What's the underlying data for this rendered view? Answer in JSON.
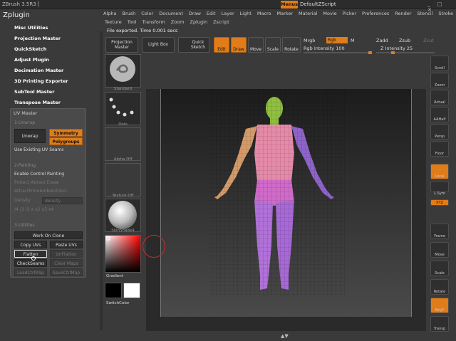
{
  "window": {
    "title": "ZBrush 3.5R3 [",
    "menus_label": "Menus",
    "script_name": "DefaultZScript"
  },
  "menubar": {
    "row1": [
      "Alpha",
      "Brush",
      "Color",
      "Document",
      "Draw",
      "Edit",
      "Layer",
      "Light",
      "Macro",
      "Marker",
      "Material",
      "Movie",
      "Picker",
      "Preferences",
      "Render",
      "Stencil",
      "Stroke"
    ],
    "row2": [
      "Texture",
      "Tool",
      "Transform",
      "Zoom",
      "Zplugin",
      "Zscript"
    ]
  },
  "status": "File exported. Time 0.001 secs",
  "zplugin": {
    "title": "Zplugin",
    "items": [
      "Misc Utilities",
      "Projection Master",
      "QuickSketch",
      "Adjust Plugin",
      "Decimation Master",
      "3D Printing Exporter",
      "SubTool Master",
      "Transpose Master"
    ]
  },
  "uvmaster": {
    "title": "UV Master",
    "sec1": "1-Unwrap",
    "unwrap": "Unwrap",
    "symmetry": "Symmetry",
    "polygroups": "Polygroups",
    "use_existing": "Use Existing UV Seams",
    "sec2": "2-Painting",
    "enable_cp": "Enable Control Painting",
    "protect_attract": "Protect  Attract  Erase",
    "attract_ao": "AttractFromAmbientOccl",
    "density": "Density",
    "density_slider": "density",
    "density_vals": [
      "/4",
      "/3",
      "/2",
      "x",
      "x2",
      "x3",
      "x4"
    ],
    "sec3": "3-Utilities",
    "work_on_clone": "Work On Clone",
    "copy_uvs": "Copy UVs",
    "paste_uvs": "Paste UVs",
    "flatten": "Flatten",
    "unflatten": "UnFlatten",
    "check_seams": "CheckSeams",
    "clear_maps": "Clear Maps",
    "load_ctrl": "LoadCtrlMap",
    "save_ctrl": "SaveCtrlMap"
  },
  "toolbar": {
    "projection_master": "Projection Master",
    "lightbox": "Light Box",
    "quick_sketch": "Quick Sketch",
    "edit": "Edit",
    "draw": "Draw",
    "move": "Move",
    "scale": "Scale",
    "rotate": "Rotate",
    "mrgb": "Mrgb",
    "rgb": "Rgb",
    "m": "M",
    "rgb_intensity": "Rgb  Intensity 100",
    "zadd": "Zadd",
    "zsub": "Zsub",
    "zcut": "Zcut",
    "z_intensity": "Z  Intensity 25",
    "rgb_intensity_value": 100,
    "z_intensity_value": 25
  },
  "tools": {
    "standard": "Standard",
    "dots": "Dots",
    "alpha": "Alpha Off",
    "texture": "Texture Off",
    "material": "SkinShade4",
    "gradient": "Gradient",
    "switchcolor": "SwitchColor"
  },
  "tray": [
    "Scroll",
    "Zoom",
    "Actual",
    "AAHalf",
    "Persp",
    "Floor",
    "Local",
    "L.Sym",
    "XYZ",
    "Frame",
    "Move",
    "Scale",
    "Rotate",
    "PolyF",
    "Transp"
  ],
  "colors": {
    "accent": "#e07c1a",
    "head": "#8fbf3f",
    "torso": "#e58aa8",
    "arm_l": "#d49b6a",
    "arm_r": "#8f64c9",
    "legs": "#b071d8"
  }
}
